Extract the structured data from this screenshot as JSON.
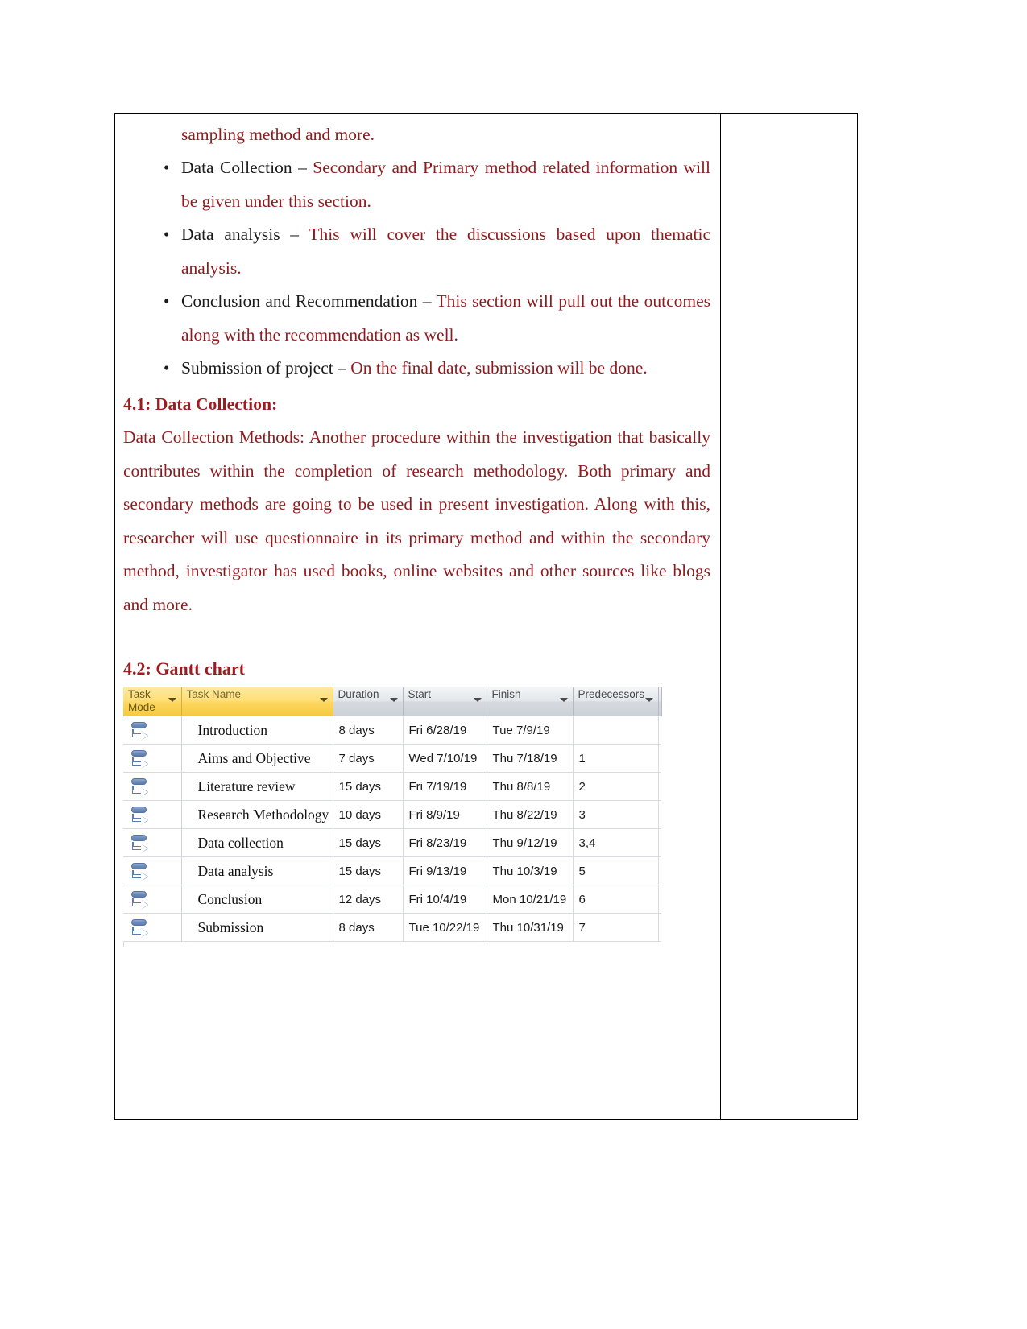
{
  "document": {
    "continued_line": "sampling method and more.",
    "bullets": [
      {
        "lead": "Data Collection – ",
        "rest": "Secondary and Primary method related information will be given under this section."
      },
      {
        "lead": "Data analysis – ",
        "rest": "This will cover the discussions based upon thematic analysis."
      },
      {
        "lead": "Conclusion and Recommendation – ",
        "rest": "This section will pull out the outcomes along with the recommendation as well."
      },
      {
        "lead": "Submission of project – ",
        "rest": "On the final date, submission will be done."
      }
    ],
    "section_4_1_heading": "4.1: Data Collection:",
    "methods_heading": "Data Collection Methods:",
    "methods_body": " Another procedure within the investigation that basically contributes within the completion of research methodology. Both primary and secondary methods are going to be used in present investigation. Along with this, researcher will use questionnaire in its primary method and within the secondary method, investigator has used books, online websites and other sources like blogs and more.",
    "section_4_2_heading": "4.2: Gantt chart"
  },
  "colors": {
    "body_red": "#8f1a1e",
    "heading_red": "#9c1c20",
    "lead_black": "#1b1b1b",
    "header_gold": "#fcd65f",
    "header_gray": "#d6dae0",
    "mode_icon_blue": "#5b7db0",
    "page_border": "#000000"
  },
  "gantt": {
    "columns": [
      {
        "label": "Task Mode",
        "key": "mode",
        "highlight": true
      },
      {
        "label": "Task Name",
        "key": "name",
        "highlight": true
      },
      {
        "label": "Duration",
        "key": "duration",
        "highlight": false
      },
      {
        "label": "Start",
        "key": "start",
        "highlight": false
      },
      {
        "label": "Finish",
        "key": "finish",
        "highlight": false
      },
      {
        "label": "Predecessors",
        "key": "predecessors",
        "highlight": false
      }
    ],
    "filter_icon": "chevron-down-icon",
    "task_mode_icon": "auto-schedule-icon",
    "rows": [
      {
        "mode": "Auto Scheduled",
        "name": "Introduction",
        "duration": "8 days",
        "start": "Fri 6/28/19",
        "finish": "Tue 7/9/19",
        "predecessors": ""
      },
      {
        "mode": "Auto Scheduled",
        "name": "Aims and Objective",
        "duration": "7 days",
        "start": "Wed 7/10/19",
        "finish": "Thu 7/18/19",
        "predecessors": "1"
      },
      {
        "mode": "Auto Scheduled",
        "name": "Literature review",
        "duration": "15 days",
        "start": "Fri 7/19/19",
        "finish": "Thu 8/8/19",
        "predecessors": "2"
      },
      {
        "mode": "Auto Scheduled",
        "name": "Research Methodology",
        "duration": "10 days",
        "start": "Fri 8/9/19",
        "finish": "Thu 8/22/19",
        "predecessors": "3"
      },
      {
        "mode": "Auto Scheduled",
        "name": "Data collection",
        "duration": "15 days",
        "start": "Fri 8/23/19",
        "finish": "Thu 9/12/19",
        "predecessors": "3,4"
      },
      {
        "mode": "Auto Scheduled",
        "name": "Data analysis",
        "duration": "15 days",
        "start": "Fri 9/13/19",
        "finish": "Thu 10/3/19",
        "predecessors": "5"
      },
      {
        "mode": "Auto Scheduled",
        "name": "Conclusion",
        "duration": "12 days",
        "start": "Fri 10/4/19",
        "finish": "Mon 10/21/19",
        "predecessors": "6"
      },
      {
        "mode": "Auto Scheduled",
        "name": "Submission",
        "duration": "8 days",
        "start": "Tue 10/22/19",
        "finish": "Thu 10/31/19",
        "predecessors": "7"
      }
    ]
  },
  "chart_data": {
    "type": "table",
    "title": "4.2: Gantt chart",
    "columns": [
      "Task Mode",
      "Task Name",
      "Duration",
      "Start",
      "Finish",
      "Predecessors"
    ],
    "rows": [
      [
        "Auto Scheduled",
        "Introduction",
        "8 days",
        "Fri 6/28/19",
        "Tue 7/9/19",
        ""
      ],
      [
        "Auto Scheduled",
        "Aims and Objective",
        "7 days",
        "Wed 7/10/19",
        "Thu 7/18/19",
        "1"
      ],
      [
        "Auto Scheduled",
        "Literature review",
        "15 days",
        "Fri 7/19/19",
        "Thu 8/8/19",
        "2"
      ],
      [
        "Auto Scheduled",
        "Research Methodology",
        "10 days",
        "Fri 8/9/19",
        "Thu 8/22/19",
        "3"
      ],
      [
        "Auto Scheduled",
        "Data collection",
        "15 days",
        "Fri 8/23/19",
        "Thu 9/12/19",
        "3,4"
      ],
      [
        "Auto Scheduled",
        "Data analysis",
        "15 days",
        "Fri 9/13/19",
        "Thu 10/3/19",
        "5"
      ],
      [
        "Auto Scheduled",
        "Conclusion",
        "12 days",
        "Fri 10/4/19",
        "Mon 10/21/19",
        "6"
      ],
      [
        "Auto Scheduled",
        "Submission",
        "8 days",
        "Tue 10/22/19",
        "Thu 10/31/19",
        "7"
      ]
    ]
  }
}
